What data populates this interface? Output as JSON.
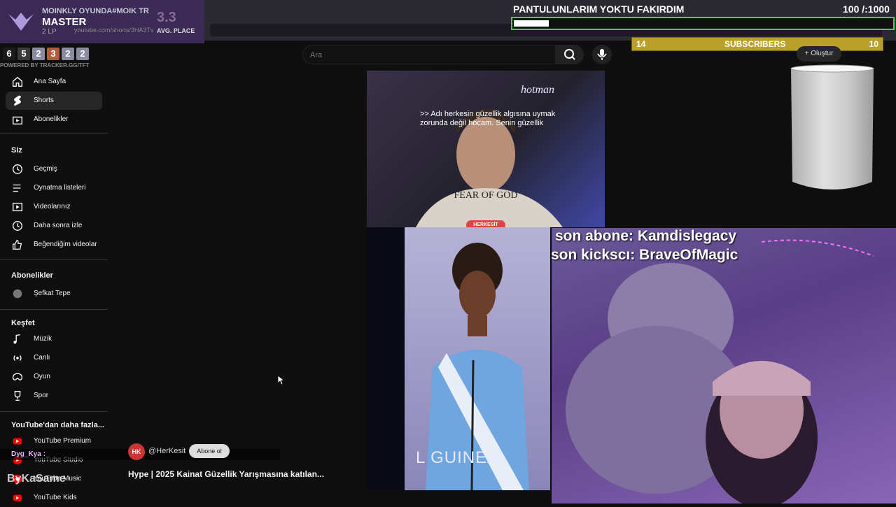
{
  "tft": {
    "name": "MOINKLY OYUNDA#MOIK TR",
    "rank": "MASTER",
    "lp": "2 LP",
    "url": "youtube.com/shorts/3HA3Tv",
    "avg_value": "3.3",
    "avg_label": "AVG. PLACE",
    "placements": [
      {
        "value": "6",
        "color": "#1b1b1b"
      },
      {
        "value": "5",
        "color": "#3a3a3a"
      },
      {
        "value": "2",
        "color": "#8a8aa0"
      },
      {
        "value": "3",
        "color": "#b25c3c"
      },
      {
        "value": "2",
        "color": "#8a8aa0"
      },
      {
        "value": "2",
        "color": "#8a8aa0"
      }
    ],
    "powered": "POWERED BY TRACKER.GG/TFT"
  },
  "goal": {
    "title": "PANTULUNLARIM YOKTU FAKIRDIM",
    "count": "100  /:1000",
    "progress": 0.1
  },
  "subs": {
    "left": "14",
    "label": "SUBSCRIBERS",
    "right": "10"
  },
  "search": {
    "placeholder": "Ara"
  },
  "create_label": "Oluştur",
  "sidebar": {
    "main": [
      {
        "label": "Ana Sayfa",
        "icon": "home-icon"
      },
      {
        "label": "Shorts",
        "icon": "shorts-icon",
        "active": true
      },
      {
        "label": "Abonelikler",
        "icon": "subscriptions-icon"
      }
    ],
    "you_heading": "Siz",
    "you": [
      {
        "label": "Geçmiş",
        "icon": "history-icon"
      },
      {
        "label": "Oynatma listeleri",
        "icon": "playlist-icon"
      },
      {
        "label": "Videolarınız",
        "icon": "your-videos-icon"
      },
      {
        "label": "Daha sonra izle",
        "icon": "watch-later-icon"
      },
      {
        "label": "Beğendiğim videolar",
        "icon": "liked-icon"
      }
    ],
    "subs_heading": "Abonelikler",
    "subs": [
      {
        "label": "Şefkat Tepe",
        "icon": "channel-avatar-icon"
      }
    ],
    "explore_heading": "Keşfet",
    "explore": [
      {
        "label": "Müzik",
        "icon": "music-icon"
      },
      {
        "label": "Canlı",
        "icon": "live-icon"
      },
      {
        "label": "Oyun",
        "icon": "gaming-icon"
      },
      {
        "label": "Spor",
        "icon": "trophy-icon"
      }
    ],
    "more_heading": "YouTube'dan daha fazla...",
    "more": [
      {
        "label": "YouTube Premium",
        "icon": "yt-premium-icon"
      },
      {
        "label": "YouTube Studio",
        "icon": "yt-studio-icon"
      },
      {
        "label": "YouTube Music",
        "icon": "yt-music-icon"
      },
      {
        "label": "YouTube Kids",
        "icon": "yt-kids-icon"
      }
    ]
  },
  "video": {
    "caption_1": ">> Adı herkesin güzellik algısına uymak",
    "caption_2": "zorunda değil hocam. Senin güzellik",
    "badge": "HERKESİT",
    "sash": "L GUINEA",
    "channel_avatar": "HK",
    "channel": "@HerKesit",
    "subscribe": "Abone ol",
    "title": "Hype | 2025 Kainat Güzellik Yarışmasına katılan..."
  },
  "overlay": {
    "last_sub": "son abone: Kamdislegacy",
    "last_kick": "son kickscı: BraveOfMagic"
  },
  "chat": {
    "user": "Dyg_Kya :"
  },
  "watermark": "ByKaSame"
}
